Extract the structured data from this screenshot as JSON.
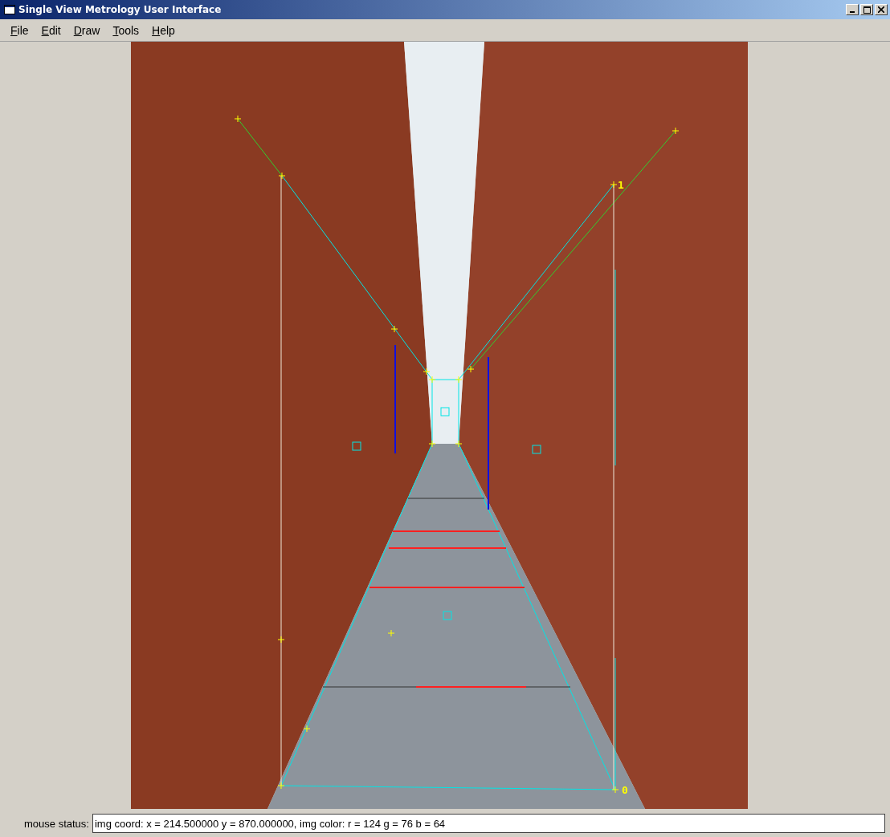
{
  "window": {
    "title": "Single View Metrology User Interface"
  },
  "menu": [
    {
      "label": "File"
    },
    {
      "label": "Edit"
    },
    {
      "label": "Draw"
    },
    {
      "label": "Tools"
    },
    {
      "label": "Help"
    }
  ],
  "point_labels": [
    "1",
    "0"
  ],
  "status_bar": {
    "label": "mouse status:",
    "value": "img coord: x = 214.500000 y = 870.000000, img color: r = 124 g = 76 b = 64"
  }
}
